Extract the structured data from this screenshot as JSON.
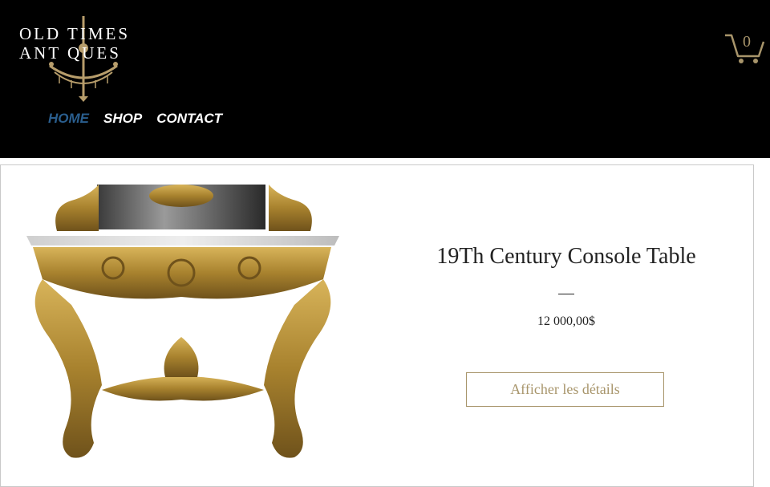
{
  "logo": {
    "line1": "OLD  TIMES",
    "line2": "ANT   QUES",
    "icon": "chandelier-icon"
  },
  "nav": {
    "items": [
      {
        "label": "HOME",
        "active": true
      },
      {
        "label": "SHOP",
        "active": false
      },
      {
        "label": "CONTACT",
        "active": false
      }
    ]
  },
  "cart": {
    "count": "0",
    "icon": "cart-icon"
  },
  "product": {
    "title": "19Th Century Console Table",
    "price": "12 000,00$",
    "button_label": "Afficher les détails",
    "image_icon": "console-table-image"
  },
  "colors": {
    "header_bg": "#000000",
    "accent_gold": "#a8956b",
    "nav_active": "#2a5e8e"
  }
}
